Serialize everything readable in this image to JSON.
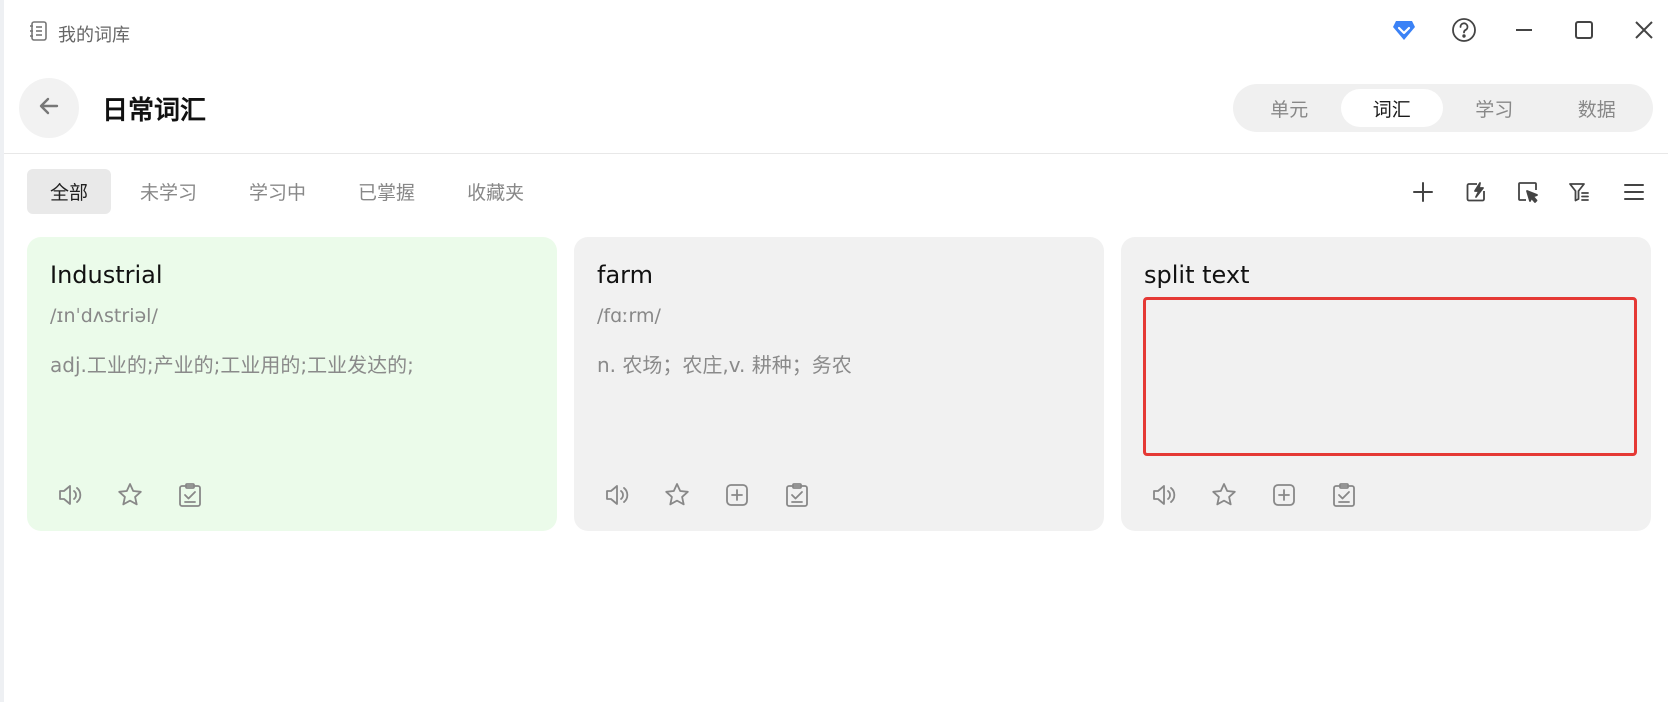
{
  "window": {
    "app_title": "我的词库",
    "controls": [
      "vip-diamond-icon",
      "help-icon",
      "minimize-icon",
      "maximize-icon",
      "close-icon"
    ],
    "accent_color": "#3b82f6"
  },
  "header": {
    "title": "日常词汇",
    "segments": [
      "单元",
      "词汇",
      "学习",
      "数据"
    ],
    "active_segment": "词汇"
  },
  "filter": {
    "tabs": [
      "全部",
      "未学习",
      "学习中",
      "已掌握",
      "收藏夹"
    ],
    "active_tab": "全部",
    "tools": [
      "add-icon",
      "quick-edit-icon",
      "select-icon",
      "filter-icon",
      "menu-icon"
    ]
  },
  "cards": [
    {
      "word": "Industrial",
      "phonetic": "/ɪnˈdʌstriəl/",
      "definition": "adj.工业的;产业的;工业用的;工业发达的;",
      "status_color": "#ebfbea"
    },
    {
      "word": "farm",
      "phonetic": "/fɑːrm/",
      "definition": "n. 农场；农庄,v. 耕种；务农"
    },
    {
      "word": "split text",
      "phonetic": "",
      "definition": "",
      "highlight_color": "#e53935"
    }
  ]
}
